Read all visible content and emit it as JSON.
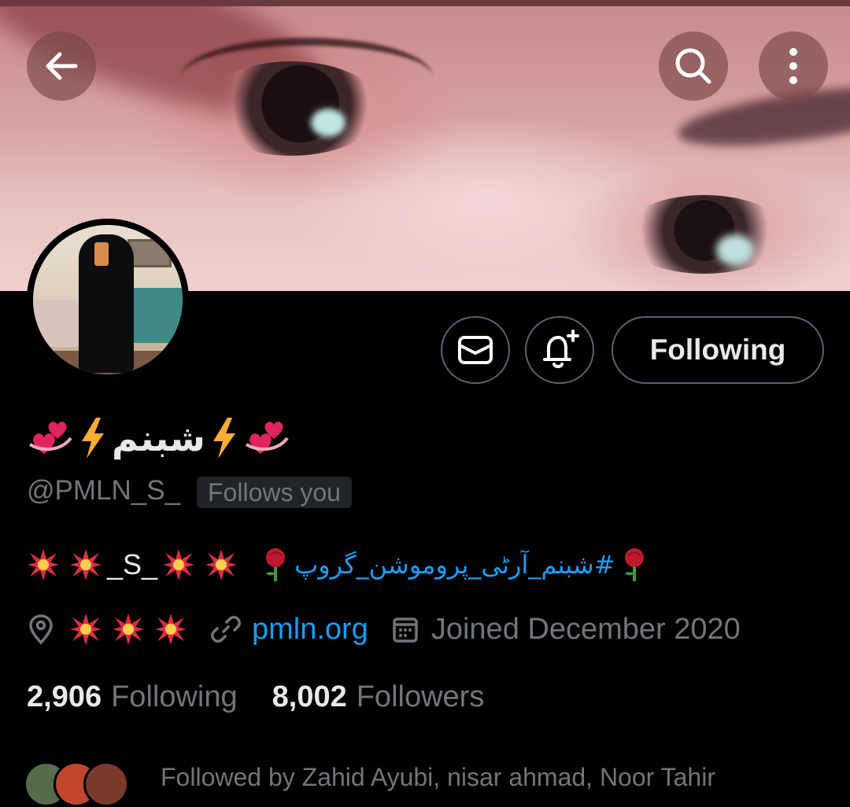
{
  "header": {
    "back_icon": "arrow-left-icon",
    "search_icon": "search-icon",
    "more_icon": "more-vertical-icon"
  },
  "profile": {
    "display_name": "شبنم",
    "handle": "@PMLN_S_",
    "follows_you": "Follows you",
    "bio": {
      "name_tag": "_S_",
      "hashtag": "#شبنم_آرٹی_پروموشن_گروپ"
    },
    "link": "pmln.org",
    "joined": "Joined December 2020",
    "following_count": "2,906",
    "following_label": "Following",
    "followers_count": "8,002",
    "followers_label": "Followers",
    "followed_by": "Followed by Zahid Ayubi, nisar ahmad, Noor Tahir"
  },
  "actions": {
    "message_icon": "mail-icon",
    "notify_icon": "bell-plus-icon",
    "follow_button": "Following"
  },
  "colors": {
    "background": "#000000",
    "text": "#e7e9ea",
    "muted": "#71767b",
    "accent_link": "#1d9bf0",
    "border": "#536471"
  }
}
